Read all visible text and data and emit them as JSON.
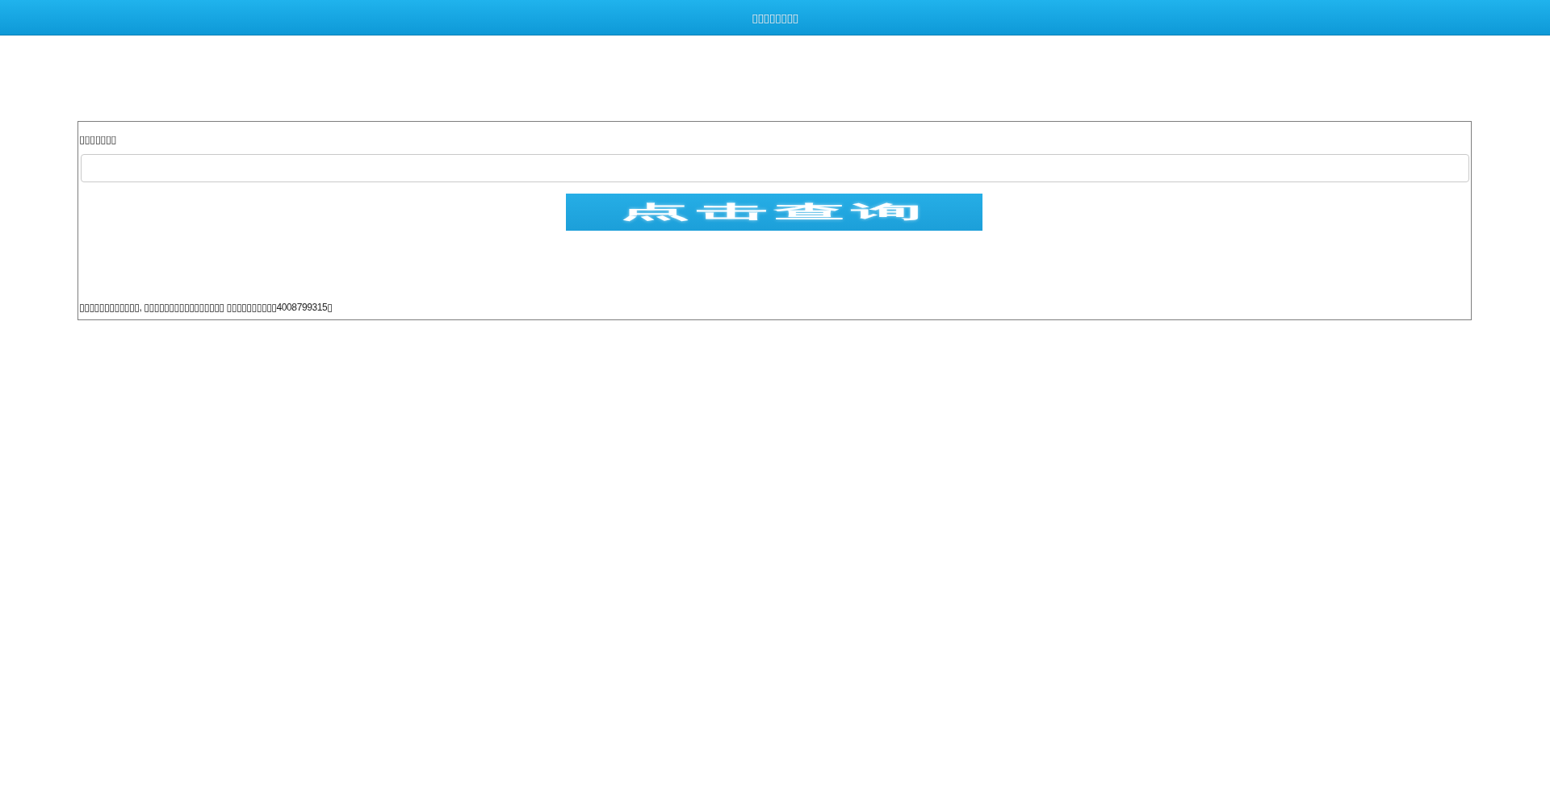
{
  "header": {
    "title": "▯▯▯▯▯▯▯▯"
  },
  "form": {
    "label": "▯▯▯▯▯▯▯",
    "button": "点击查询"
  },
  "notice": "▯▯▯▯▯▯▯▯▯▯▯▯, ▯▯▯▯▯▯▯▯▯▯▯▯▯▯▯▯ ▯▯▯▯▯▯▯▯▯▯4008799315▯"
}
